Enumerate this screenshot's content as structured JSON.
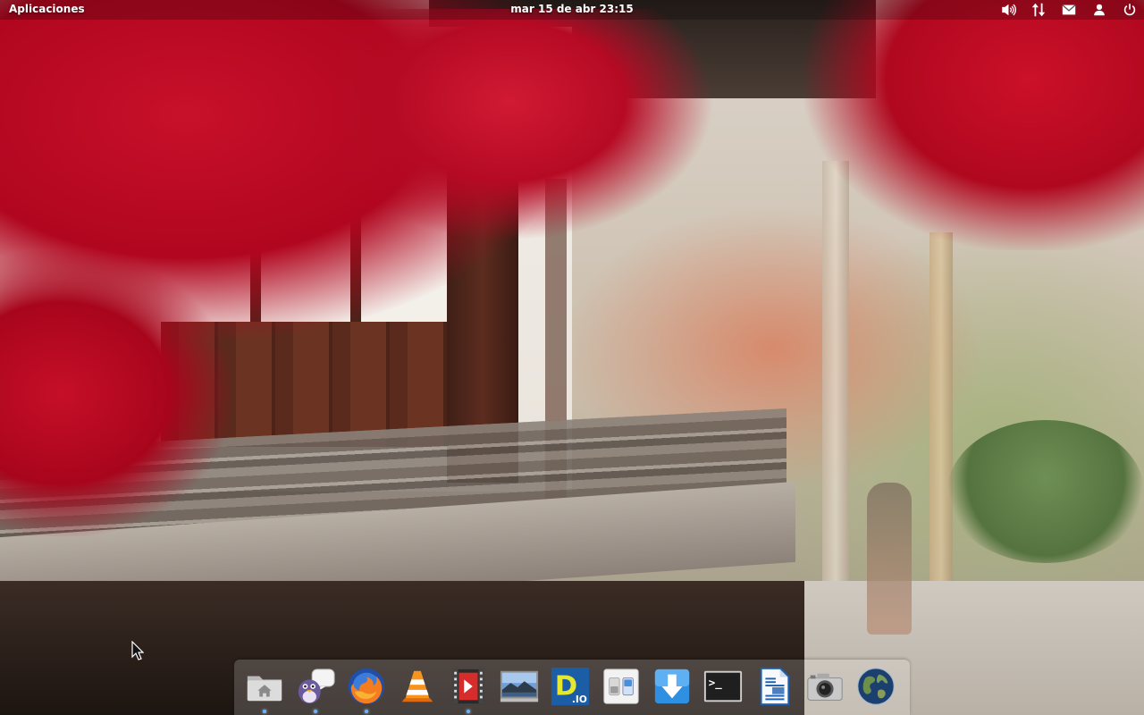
{
  "top_panel": {
    "applications_label": "Aplicaciones",
    "clock": "mar 15 de abr 23:15",
    "indicators": [
      {
        "name": "volume",
        "icon": "speaker-icon"
      },
      {
        "name": "network",
        "icon": "network-arrows-icon"
      },
      {
        "name": "messages",
        "icon": "envelope-icon"
      },
      {
        "name": "user",
        "icon": "user-icon"
      },
      {
        "name": "session",
        "icon": "power-icon"
      }
    ]
  },
  "dock": {
    "items": [
      {
        "name": "files",
        "icon": "folder-home-icon",
        "running": true
      },
      {
        "name": "pidgin",
        "icon": "chat-bird-icon",
        "running": true
      },
      {
        "name": "firefox",
        "icon": "firefox-icon",
        "running": true
      },
      {
        "name": "vlc",
        "icon": "traffic-cone-icon",
        "running": false
      },
      {
        "name": "video-editor",
        "icon": "film-play-icon",
        "running": true
      },
      {
        "name": "image-viewer",
        "icon": "landscape-photo-icon",
        "running": false
      },
      {
        "name": "draw-io",
        "icon": "draw-io-icon",
        "label": "D",
        "sublabel": ".IO",
        "running": false
      },
      {
        "name": "system-settings",
        "icon": "toggle-switches-icon",
        "running": false
      },
      {
        "name": "downloads",
        "icon": "download-arrow-icon",
        "running": false
      },
      {
        "name": "terminal",
        "icon": "terminal-icon",
        "label": ">_",
        "running": false
      },
      {
        "name": "writer",
        "icon": "document-writer-icon",
        "running": false
      },
      {
        "name": "camera",
        "icon": "camera-icon",
        "running": false
      },
      {
        "name": "earth",
        "icon": "globe-icon",
        "running": false
      }
    ]
  },
  "colors": {
    "maple_red": "#c8102a",
    "panel_bg": "#000000",
    "dock_indicator": "#6fb0ff",
    "terminal_bg": "#1f1f1f",
    "firefox_orange": "#f57c1f",
    "download_blue": "#2f8fe0"
  }
}
